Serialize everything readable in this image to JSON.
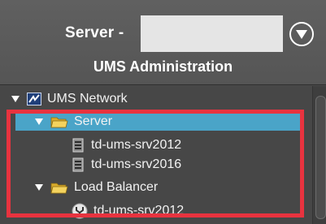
{
  "header": {
    "server_label": "Server -",
    "menu_icon": "chevron-down-circle-icon",
    "title": "UMS Administration"
  },
  "tree": {
    "root": {
      "label": "UMS Network",
      "icon": "ums-network-icon",
      "expanded": true
    },
    "server_folder": {
      "label": "Server",
      "icon": "folder-icon",
      "expanded": true,
      "selected": true,
      "children": [
        {
          "label": "td-ums-srv2012",
          "icon": "server-icon"
        },
        {
          "label": "td-ums-srv2016",
          "icon": "server-icon"
        }
      ]
    },
    "load_balancer_folder": {
      "label": "Load Balancer",
      "icon": "folder-icon",
      "expanded": true,
      "children": [
        {
          "label": "td-ums-srv2012",
          "icon": "load-balancer-icon"
        }
      ]
    }
  },
  "colors": {
    "selection": "#4aa4c8",
    "highlight_border": "#e8333f",
    "folder": "#f0c948",
    "background": "#474747"
  }
}
